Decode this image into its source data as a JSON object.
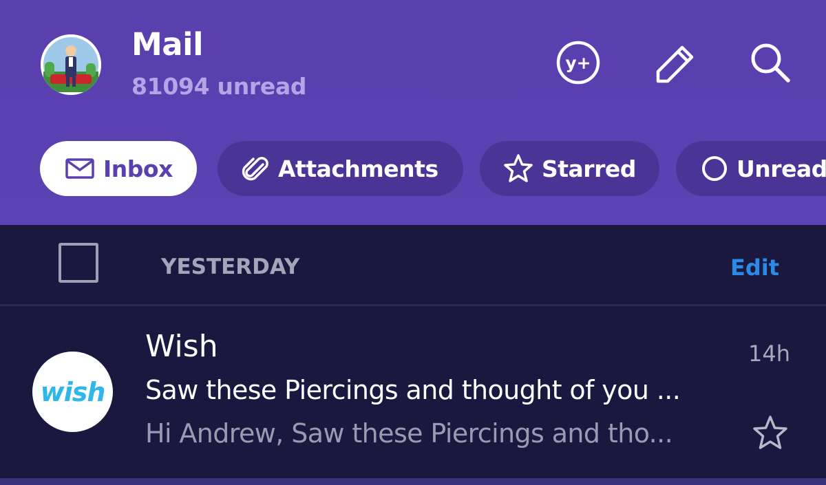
{
  "header": {
    "title": "Mail",
    "unread_text": "81094 unread",
    "icons": [
      "yahoo-plus-icon",
      "compose-icon",
      "search-icon"
    ],
    "background_color": "#5a3fae"
  },
  "filters": [
    {
      "label": "Inbox",
      "icon": "envelope-icon",
      "active": true
    },
    {
      "label": "Attachments",
      "icon": "paperclip-icon",
      "active": false
    },
    {
      "label": "Starred",
      "icon": "star-icon",
      "active": false
    },
    {
      "label": "Unread",
      "icon": "circle-icon",
      "active": false
    }
  ],
  "section": {
    "label": "YESTERDAY",
    "edit_label": "Edit",
    "edit_color": "#2b8ae6"
  },
  "messages": [
    {
      "sender": "Wish",
      "logo_text": "wish",
      "time": "14h",
      "subject": "Saw these Piercings and thought of you ...",
      "preview": "Hi Andrew, Saw these Piercings and tho...",
      "starred": false
    }
  ]
}
